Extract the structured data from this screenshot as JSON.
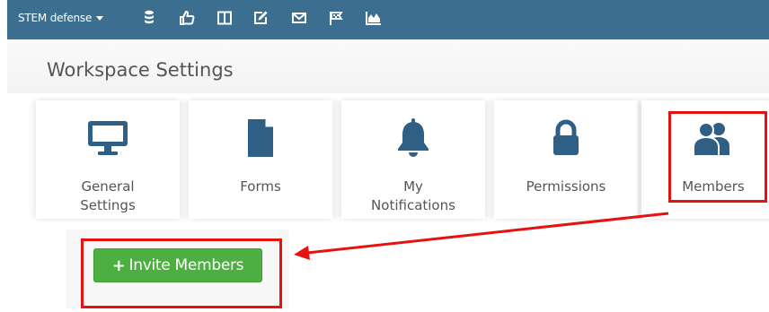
{
  "topbar": {
    "workspace_label": "STEM defense",
    "icons": [
      "database-icon",
      "thumbs-up-icon",
      "columns-icon",
      "edit-icon",
      "envelope-icon",
      "flag-icon",
      "area-chart-icon"
    ]
  },
  "page": {
    "title": "Workspace Settings"
  },
  "cards": [
    {
      "label": "General\nSettings",
      "icon": "desktop-icon"
    },
    {
      "label": "Forms",
      "icon": "file-icon"
    },
    {
      "label": "My\nNotifications",
      "icon": "bell-icon"
    },
    {
      "label": "Permissions",
      "icon": "lock-icon"
    },
    {
      "label": "Members",
      "icon": "users-icon"
    }
  ],
  "invite": {
    "label": "Invite Members",
    "plus": "+"
  },
  "colors": {
    "topbar": "#3b6e8f",
    "icon": "#2f5f84",
    "button": "#4caf40",
    "annotation": "#e51212"
  }
}
